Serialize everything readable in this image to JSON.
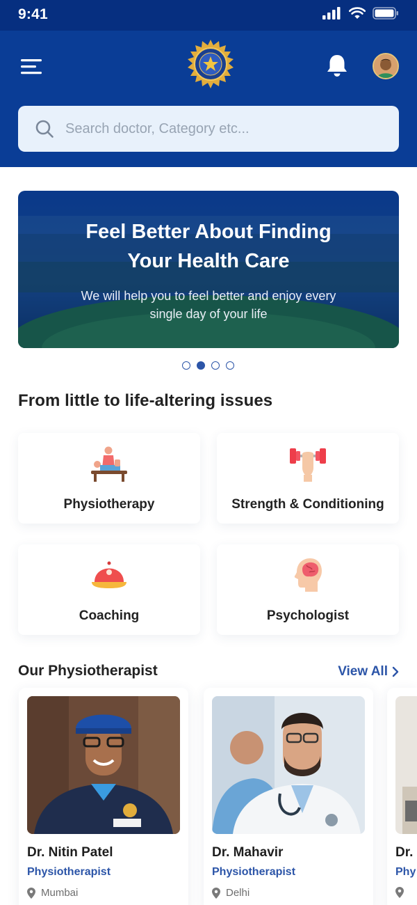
{
  "status": {
    "time": "9:41"
  },
  "search": {
    "placeholder": "Search doctor, Category etc..."
  },
  "banner": {
    "title_line1": "Feel Better About Finding",
    "title_line2": "Your Health Care",
    "subtitle_line1": "We will help you to feel better and enjoy every",
    "subtitle_line2": "single day of your life",
    "active_slide": 2,
    "slide_count": 4
  },
  "categories": {
    "title": "From little to life-altering issues",
    "items": [
      {
        "label": "Physiotherapy",
        "icon": "physiotherapy-icon"
      },
      {
        "label": "Strength & Conditioning",
        "icon": "dumbbell-icon"
      },
      {
        "label": "Coaching",
        "icon": "cap-icon"
      },
      {
        "label": "Psychologist",
        "icon": "brain-icon"
      }
    ]
  },
  "physio": {
    "title": "Our Physiotherapist",
    "view_all": "View All",
    "doctors": [
      {
        "name": "Dr. Nitin Patel",
        "specialty": "Physiotherapist",
        "location": "Mumbai"
      },
      {
        "name": "Dr. Mahavir",
        "specialty": "Physiotherapist",
        "location": "Delhi"
      },
      {
        "name": "Dr. I",
        "specialty": "Phy",
        "location": ""
      }
    ]
  },
  "colors": {
    "primary": "#0a3d96",
    "accent": "#2c55a8",
    "search_bg": "#e8f1fb"
  }
}
